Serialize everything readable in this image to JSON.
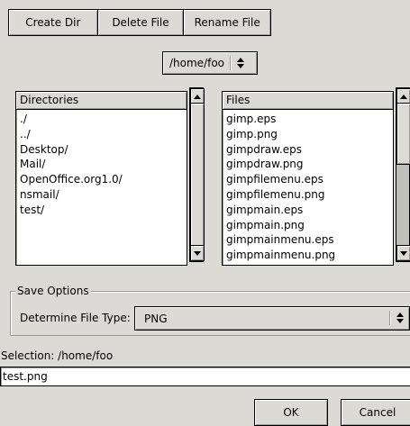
{
  "toolbar": {
    "create_dir": "Create Dir",
    "delete_file": "Delete File",
    "rename_file": "Rename File"
  },
  "path_combo": {
    "value": "/home/foo"
  },
  "directories": {
    "header": "Directories",
    "items": [
      "./",
      "../",
      "Desktop/",
      "Mail/",
      "OpenOffice.org1.0/",
      "nsmail/",
      "test/"
    ]
  },
  "files": {
    "header": "Files",
    "items": [
      "gimp.eps",
      "gimp.png",
      "gimpdraw.eps",
      "gimpdraw.png",
      "gimpfilemenu.eps",
      "gimpfilemenu.png",
      "gimpmain.eps",
      "gimpmain.png",
      "gimpmainmenu.eps",
      "gimpmainmenu.png"
    ]
  },
  "save_options": {
    "title": "Save Options",
    "file_type_label": "Determine File Type:",
    "file_type_value": "PNG"
  },
  "selection": {
    "label": "Selection: /home/foo",
    "value": "test.png"
  },
  "buttons": {
    "ok": "OK",
    "cancel": "Cancel"
  }
}
